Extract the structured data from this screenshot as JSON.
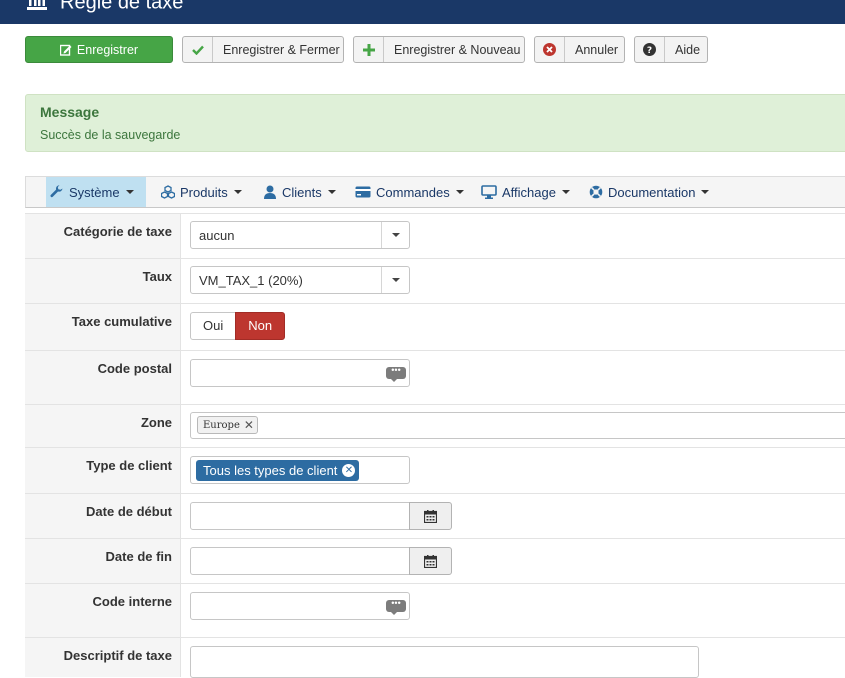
{
  "page": {
    "title": "Règle de taxe"
  },
  "toolbar": {
    "save": "Enregistrer",
    "save_close": "Enregistrer & Fermer",
    "save_new": "Enregistrer & Nouveau",
    "cancel": "Annuler",
    "help": "Aide"
  },
  "alert": {
    "heading": "Message",
    "text": "Succès de la sauvegarde"
  },
  "menu": {
    "systeme": "Système",
    "produits": "Produits",
    "clients": "Clients",
    "commandes": "Commandes",
    "affichage": "Affichage",
    "documentation": "Documentation"
  },
  "form": {
    "categorie": {
      "label": "Catégorie de taxe",
      "value": "aucun"
    },
    "taux": {
      "label": "Taux",
      "value": "VM_TAX_1 (20%)"
    },
    "cumulative": {
      "label": "Taxe cumulative",
      "yes": "Oui",
      "no": "Non",
      "selected": "Non"
    },
    "code_postal": {
      "label": "Code postal",
      "value": ""
    },
    "zone": {
      "label": "Zone",
      "chip": "Europe"
    },
    "type_client": {
      "label": "Type de client",
      "chip": "Tous les types de client"
    },
    "date_debut": {
      "label": "Date de début",
      "value": ""
    },
    "date_fin": {
      "label": "Date de fin",
      "value": ""
    },
    "code_interne": {
      "label": "Code interne",
      "value": ""
    },
    "descriptif": {
      "label": "Descriptif de taxe",
      "value": ""
    }
  },
  "colors": {
    "header": "#1a3867",
    "primary": "#46a546",
    "danger": "#bd362f",
    "chip": "#2d6ca2",
    "alert_bg": "#dff0d8",
    "menu_active": "#bfe0f1"
  }
}
